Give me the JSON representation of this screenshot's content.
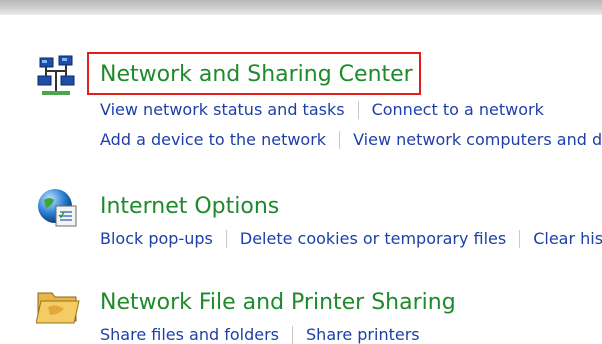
{
  "sections": [
    {
      "title": "Network and Sharing Center",
      "icon": "network-icon",
      "links_row1": [
        "View network status and tasks",
        "Connect to a network"
      ],
      "links_row2": [
        "Add a device to the network",
        "View network computers and de"
      ]
    },
    {
      "title": "Internet Options",
      "icon": "internet-options-icon",
      "links_row1": [
        "Block pop-ups",
        "Delete cookies or temporary files",
        "Clear his"
      ]
    },
    {
      "title": "Network File and Printer Sharing",
      "icon": "folder-share-icon",
      "links_row1": [
        "Share files and folders",
        "Share printers"
      ]
    }
  ],
  "colors": {
    "title": "#1e8a2b",
    "link": "#1d3fa8",
    "highlight": "#e21d1d"
  }
}
